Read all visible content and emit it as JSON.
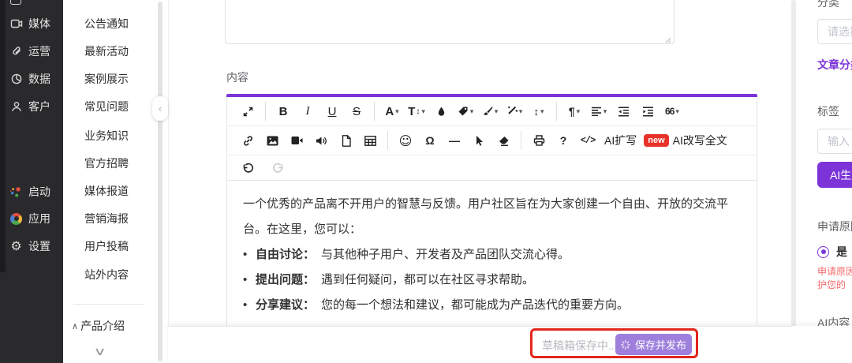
{
  "colors": {
    "accent_purple": "#7c34d9",
    "save_button_purple": "#9e7fdc",
    "ai_button_purple": "#7c34d9",
    "annotation_red": "#e1261c",
    "warning_red": "#f56c6c",
    "new_badge_red": "#e8322a"
  },
  "sidebar": {
    "items": [
      {
        "icon": "media-icon",
        "label": "媒体"
      },
      {
        "icon": "paperclip-icon",
        "label": "运营"
      },
      {
        "icon": "pie-chart-icon",
        "label": "数据"
      },
      {
        "icon": "user-icon",
        "label": "客户"
      }
    ],
    "items_bottom": [
      {
        "icon": "launcher-dots-icon",
        "label": "启动"
      },
      {
        "icon": "color-wheel-icon",
        "label": "应用"
      },
      {
        "icon": "gear-icon",
        "label": "设置",
        "gear_glyph": "⚙"
      }
    ]
  },
  "menu": {
    "items": [
      {
        "label": "公告通知"
      },
      {
        "label": "最新活动"
      },
      {
        "label": "案例展示"
      },
      {
        "label": "常见问题"
      },
      {
        "label": "业务知识"
      },
      {
        "label": "官方招聘"
      },
      {
        "label": "媒体报道"
      },
      {
        "label": "营销海报"
      },
      {
        "label": "用户投稿"
      },
      {
        "label": "站外内容"
      }
    ],
    "collapse_handle": "‹",
    "section": {
      "caret": "∧",
      "label": "产品介绍"
    },
    "more_caret": "∨"
  },
  "editor": {
    "field_label": "内容",
    "toolbar": {
      "glyphs": {
        "bold": "B",
        "italic": "I",
        "underline": "U",
        "strikethrough": "S",
        "font_color": "A",
        "font_size": "T",
        "updown": "↕",
        "paragraph": "¶",
        "blockquote": "66",
        "emoji": "☺",
        "omega": "Ω",
        "hr": "—",
        "help": "?",
        "code": "</>",
        "caret": "▾"
      },
      "labels": {
        "ai_expand": "AI扩写",
        "new_badge": "new",
        "ai_rewrite": "AI改写全文"
      },
      "row1_icons": [
        "fullscreen",
        "bold",
        "italic",
        "underline",
        "strikethrough",
        "font-color",
        "font-size",
        "background-color-droplet",
        "tag",
        "brush",
        "format-wand",
        "line-height",
        "paragraph",
        "align",
        "outdent",
        "indent",
        "blockquote"
      ],
      "row2_icons": [
        "link",
        "image",
        "video",
        "audio",
        "file",
        "table",
        "emoji",
        "special-character",
        "horizontal-rule",
        "cursor",
        "eraser",
        "print",
        "help",
        "code",
        "ai-expand",
        "ai-rewrite"
      ],
      "row3_icons": [
        "undo",
        "redo"
      ]
    },
    "content": {
      "line1": "一个优秀的产品离不开用户的智慧与反馈。用户社区旨在为大家创建一个自由、开放的交流平",
      "line2": "台。在这里，您可以：",
      "bullets": [
        {
          "title": "自由讨论：",
          "text": "与其他种子用户、开发者及产品团队交流心得。"
        },
        {
          "title": "提出问题：",
          "text": "遇到任何疑问，都可以在社区寻求帮助。"
        },
        {
          "title": "分享建议：",
          "text": "您的每一个想法和建议，都可能成为产品迭代的重要方向。"
        }
      ]
    }
  },
  "panel": {
    "category_label": "分类",
    "category_placeholder": "请选择",
    "category_link": "文章分类",
    "tag_label": "标签",
    "tag_placeholder": "输入",
    "ai_generate_label": "AI生成",
    "reason_label": "申请原因",
    "radio_yes": "是",
    "warning_line1": "申请原因",
    "warning_line2": "护您的",
    "ai_content_label": "AI内容"
  },
  "footer": {
    "draft_status": "草稿箱保存中...",
    "save_label": "保存并发布"
  }
}
